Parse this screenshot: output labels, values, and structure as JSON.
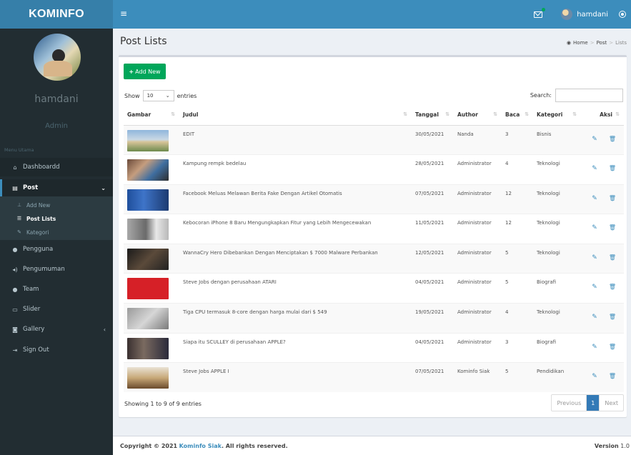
{
  "header": {
    "logo": "KOMINFO",
    "user": "hamdani",
    "toggle_icon": "≡"
  },
  "sidebar": {
    "name": "hamdani",
    "role": "Admin",
    "menu_header": "Menu Utama",
    "items": [
      {
        "label": "Dashboardd",
        "icon": "home-icon"
      },
      {
        "label": "Post",
        "icon": "newspaper-icon"
      },
      {
        "label": "Pengguna",
        "icon": "users-icon"
      },
      {
        "label": "Pengumuman",
        "icon": "bullhorn-icon"
      },
      {
        "label": "Team",
        "icon": "users-icon"
      },
      {
        "label": "Slider",
        "icon": "slider-icon"
      },
      {
        "label": "Gallery",
        "icon": "camera-icon"
      },
      {
        "label": "Sign Out",
        "icon": "sign-out-icon"
      }
    ],
    "post_sub": [
      {
        "label": "Add New",
        "icon": "pin-icon"
      },
      {
        "label": "Post Lists",
        "icon": "list-icon"
      },
      {
        "label": "Kategori",
        "icon": "wrench-icon"
      }
    ]
  },
  "page": {
    "title": "Post Lists",
    "breadcrumb": [
      "Home",
      "Post",
      "Lists"
    ]
  },
  "toolbar": {
    "add_label": "Add New",
    "show": "Show",
    "entries": "entries",
    "length_value": "10",
    "search_label": "Search:"
  },
  "table": {
    "columns": [
      "Gambar",
      "Judul",
      "Tanggal",
      "Author",
      "Baca",
      "Kategori",
      "Aksi"
    ],
    "rows": [
      {
        "title": "EDIT",
        "date": "30/05/2021",
        "author": "Nanda",
        "reads": "3",
        "category": "Bisnis"
      },
      {
        "title": "Kampung rempk bedelau",
        "date": "28/05/2021",
        "author": "Administrator",
        "reads": "4",
        "category": "Teknologi"
      },
      {
        "title": "Facebook Meluas Melawan Berita Fake Dengan Artikel Otomatis",
        "date": "07/05/2021",
        "author": "Administrator",
        "reads": "12",
        "category": "Teknologi"
      },
      {
        "title": "Kebocoran iPhone 8 Baru Mengungkapkan Fitur yang Lebih Mengecewakan",
        "date": "11/05/2021",
        "author": "Administrator",
        "reads": "12",
        "category": "Teknologi"
      },
      {
        "title": "WannaCry Hero Dibebankan Dengan Menciptakan $ 7000 Malware Perbankan",
        "date": "12/05/2021",
        "author": "Administrator",
        "reads": "5",
        "category": "Teknologi"
      },
      {
        "title": "Steve Jobs dengan perusahaan ATARI",
        "date": "04/05/2021",
        "author": "Administrator",
        "reads": "5",
        "category": "Biografi"
      },
      {
        "title": "Tiga CPU termasuk 8-core dengan harga mulai dari $ 549",
        "date": "19/05/2021",
        "author": "Administrator",
        "reads": "4",
        "category": "Teknologi"
      },
      {
        "title": "Siapa itu SCULLEY di perusahaan APPLE?",
        "date": "04/05/2021",
        "author": "Administrator",
        "reads": "3",
        "category": "Biografi"
      },
      {
        "title": "Steve Jobs APPLE I",
        "date": "07/05/2021",
        "author": "Kominfo Siak",
        "reads": "5",
        "category": "Pendidikan"
      }
    ]
  },
  "pagination": {
    "info": "Showing 1 to 9 of 9 entries",
    "previous": "Previous",
    "current": "1",
    "next": "Next"
  },
  "footer": {
    "copyright": "Copyright © 2021",
    "brand": "Kominfo Siak",
    "rights": ". All rights reserved.",
    "version_label": "Version",
    "version": "1.0"
  },
  "colors": {
    "header": "#3c8dbc",
    "logo": "#367fa9",
    "sidebar": "#222d32",
    "add_button": "#00a65a",
    "pager_active": "#337ab7"
  }
}
